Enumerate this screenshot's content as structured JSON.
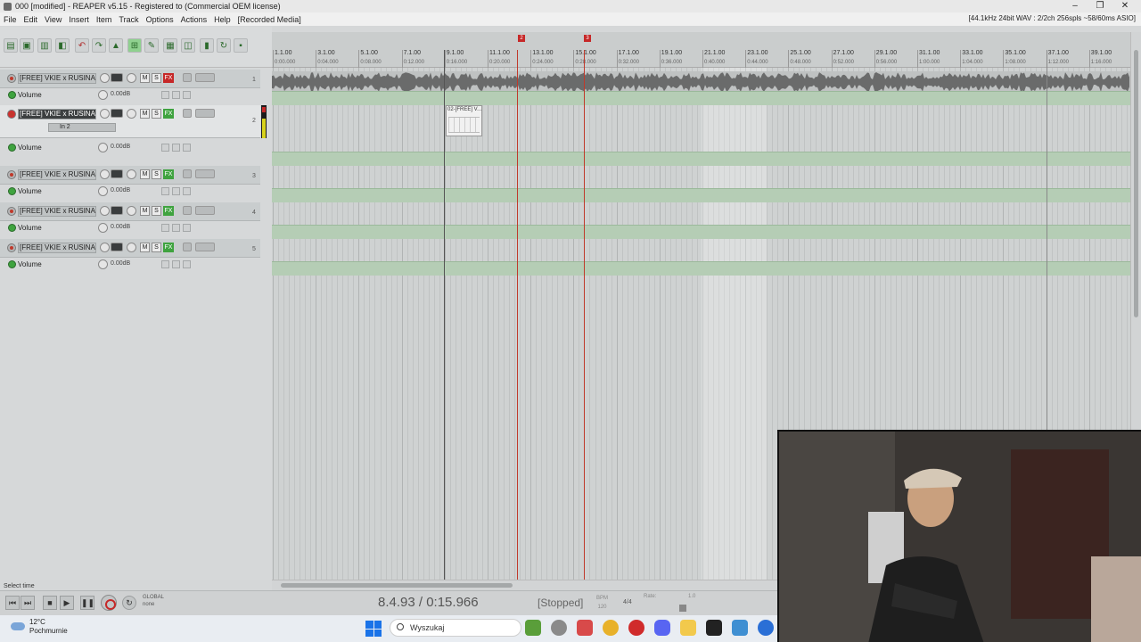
{
  "window": {
    "title": "000 [modified] - REAPER v5.15 - Registered to (Commercial OEM license)",
    "status": "[44.1kHz 24bit WAV : 2/2ch 256spls ~58/60ms ASIO]",
    "controls": [
      "–",
      "❐",
      "✕"
    ]
  },
  "menu": [
    "File",
    "Edit",
    "View",
    "Insert",
    "Item",
    "Track",
    "Options",
    "Actions",
    "Help",
    "[Recorded Media]"
  ],
  "tracks": [
    {
      "name": "[FREE] VKIE x RUSINA x V",
      "number": "1",
      "fx": "FX",
      "mute": "M",
      "solo": "S",
      "volume_label": "Volume",
      "volume_value": "0.00dB",
      "fx_state": "bypassed"
    },
    {
      "name": "[FREE] VKIE x RUSINA x V",
      "number": "2",
      "fx": "FX",
      "mute": "M",
      "solo": "S",
      "volume_label": "Volume",
      "volume_value": "0.00dB",
      "input": "In 2",
      "armed": true
    },
    {
      "name": "[FREE] VKIE x RUSINA x V",
      "number": "3",
      "fx": "FX",
      "mute": "M",
      "solo": "S",
      "volume_label": "Volume",
      "volume_value": "0.00dB"
    },
    {
      "name": "[FREE] VKIE x RUSINA x V",
      "number": "4",
      "fx": "FX",
      "mute": "M",
      "solo": "S",
      "volume_label": "Volume",
      "volume_value": "0.00dB"
    },
    {
      "name": "[FREE] VKIE x RUSINA x V",
      "number": "5",
      "fx": "FX",
      "mute": "M",
      "solo": "S",
      "volume_label": "Volume",
      "volume_value": "0.00dB"
    }
  ],
  "ruler": {
    "bars": [
      "1.1.00",
      "3.1.00",
      "5.1.00",
      "7.1.00",
      "9.1.00",
      "11.1.00",
      "13.1.00",
      "15.1.00",
      "17.1.00",
      "19.1.00",
      "21.1.00",
      "23.1.00",
      "25.1.00",
      "27.1.00",
      "29.1.00",
      "31.1.00",
      "33.1.00",
      "35.1.00",
      "37.1.00",
      "39.1.00"
    ],
    "times": [
      "0:00.000",
      "0:04.000",
      "0:08.000",
      "0:12.000",
      "0:16.000",
      "0:20.000",
      "0:24.000",
      "0:28.000",
      "0:32.000",
      "0:36.000",
      "0:40.000",
      "0:44.000",
      "0:48.000",
      "0:52.000",
      "0:56.000",
      "1:00.000",
      "1:04.000",
      "1:08.000",
      "1:12.000",
      "1:16.000"
    ],
    "markers": [
      "2",
      "3"
    ]
  },
  "media_item_label": "02-[FREE] V...",
  "transport": {
    "select_time": "Select time",
    "time": "8.4.93 / 0:15.966",
    "status": "[Stopped]",
    "bpm_label": "BPM",
    "bpm": "120",
    "time_sig": "4/4",
    "rate_label": "Rate:",
    "rate": "1.0",
    "global_label": "GLOBAL",
    "global_value": "none"
  },
  "taskbar": {
    "temp": "12°C",
    "weather": "Pochmurnie",
    "search": "Wyszukaj"
  }
}
